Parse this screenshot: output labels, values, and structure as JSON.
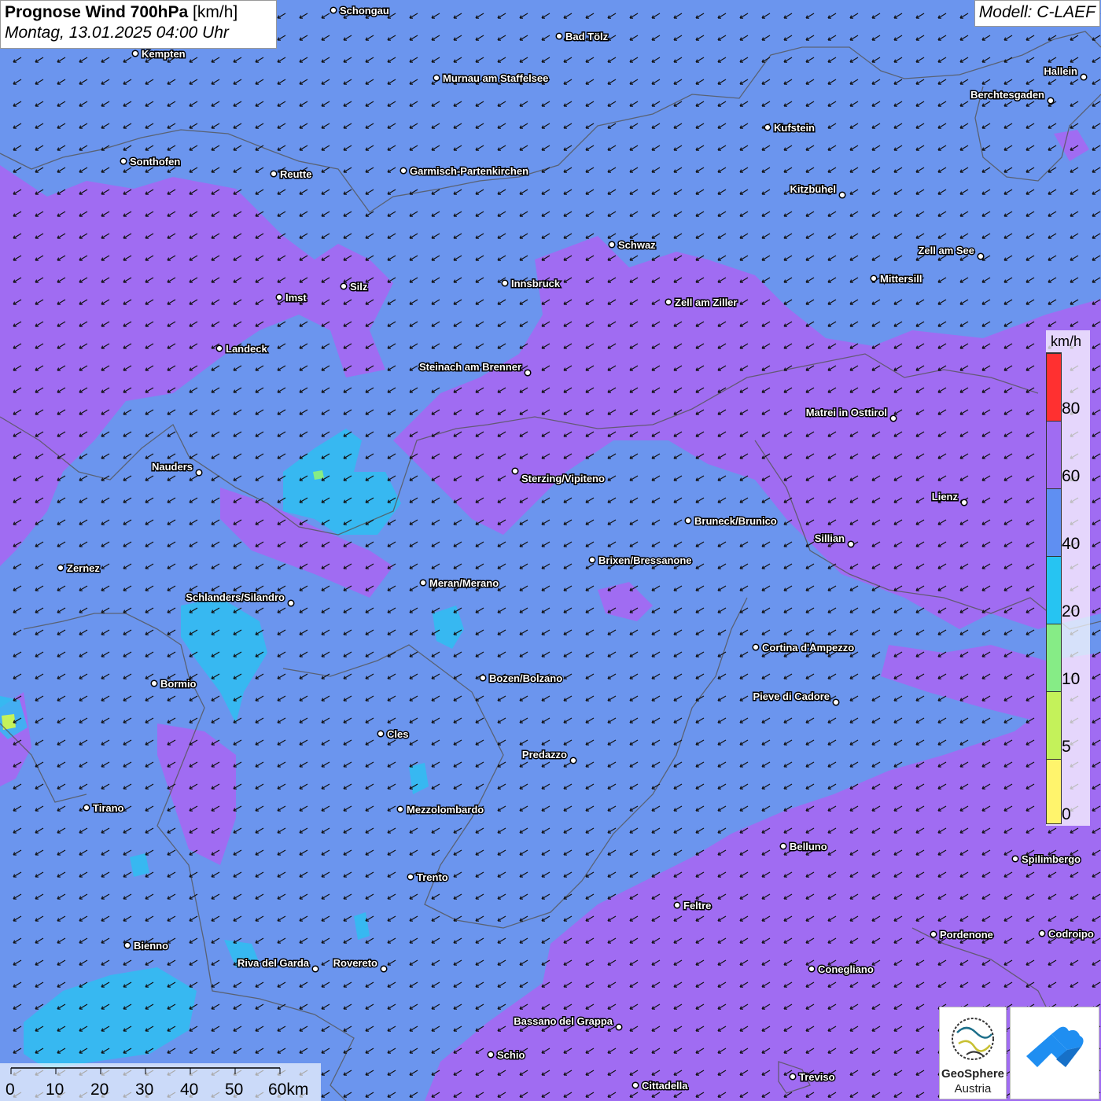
{
  "title": {
    "bold": "Prognose Wind 700hPa",
    "unit": "[km/h]",
    "datetime": "Montag, 13.01.2025 04:00 Uhr"
  },
  "model": "Modell: C-LAEF",
  "legend": {
    "unit": "km/h",
    "ticks": [
      "80",
      "60",
      "40",
      "20",
      "10",
      "5",
      "0"
    ],
    "colors": [
      "#ff3030",
      "#a06cf2",
      "#5f8ff2",
      "#26c4f2",
      "#86ec86",
      "#c4f25a",
      "#fff46c"
    ]
  },
  "scalebar": {
    "labels": [
      "0",
      "10",
      "20",
      "30",
      "40",
      "50",
      "60km"
    ]
  },
  "logos": {
    "geosphere_line1": "GeoSphere",
    "geosphere_line2": "Austria"
  },
  "wind_direction": "north-east (arrows point south-west)",
  "cities": [
    {
      "name": "Schongau"
    },
    {
      "name": "Bad Tölz"
    },
    {
      "name": "Kempten"
    },
    {
      "name": "Murnau am Staffelsee"
    },
    {
      "name": "Hallein"
    },
    {
      "name": "Berchtesgaden"
    },
    {
      "name": "Kufstein"
    },
    {
      "name": "Sonthofen"
    },
    {
      "name": "Reutte"
    },
    {
      "name": "Garmisch-Partenkirchen"
    },
    {
      "name": "Kitzbühel"
    },
    {
      "name": "Schwaz"
    },
    {
      "name": "Zell am See"
    },
    {
      "name": "Mittersill"
    },
    {
      "name": "Innsbruck"
    },
    {
      "name": "Imst"
    },
    {
      "name": "Silz"
    },
    {
      "name": "Zell am Ziller"
    },
    {
      "name": "Landeck"
    },
    {
      "name": "Steinach am Brenner"
    },
    {
      "name": "Matrei in Osttirol"
    },
    {
      "name": "Nauders"
    },
    {
      "name": "Sterzing/Vipiteno"
    },
    {
      "name": "Lienz"
    },
    {
      "name": "Bruneck/Brunico"
    },
    {
      "name": "Sillian"
    },
    {
      "name": "Brixen/Bressanone"
    },
    {
      "name": "Zernez"
    },
    {
      "name": "Meran/Merano"
    },
    {
      "name": "Schlanders/Silandro"
    },
    {
      "name": "Cortina d'Ampezzo"
    },
    {
      "name": "Bozen/Bolzano"
    },
    {
      "name": "Bormio"
    },
    {
      "name": "Pieve di Cadore"
    },
    {
      "name": "Cles"
    },
    {
      "name": "Predazzo"
    },
    {
      "name": "Tirano"
    },
    {
      "name": "Mezzolombardo"
    },
    {
      "name": "Belluno"
    },
    {
      "name": "Spilimbergo"
    },
    {
      "name": "Trento"
    },
    {
      "name": "Feltre"
    },
    {
      "name": "Pordenone"
    },
    {
      "name": "Codroipo"
    },
    {
      "name": "Bienno"
    },
    {
      "name": "Riva del Garda"
    },
    {
      "name": "Rovereto"
    },
    {
      "name": "Conegliano"
    },
    {
      "name": "Bassano del Grappa"
    },
    {
      "name": "Schio"
    },
    {
      "name": "Treviso"
    },
    {
      "name": "Cittadella"
    }
  ]
}
